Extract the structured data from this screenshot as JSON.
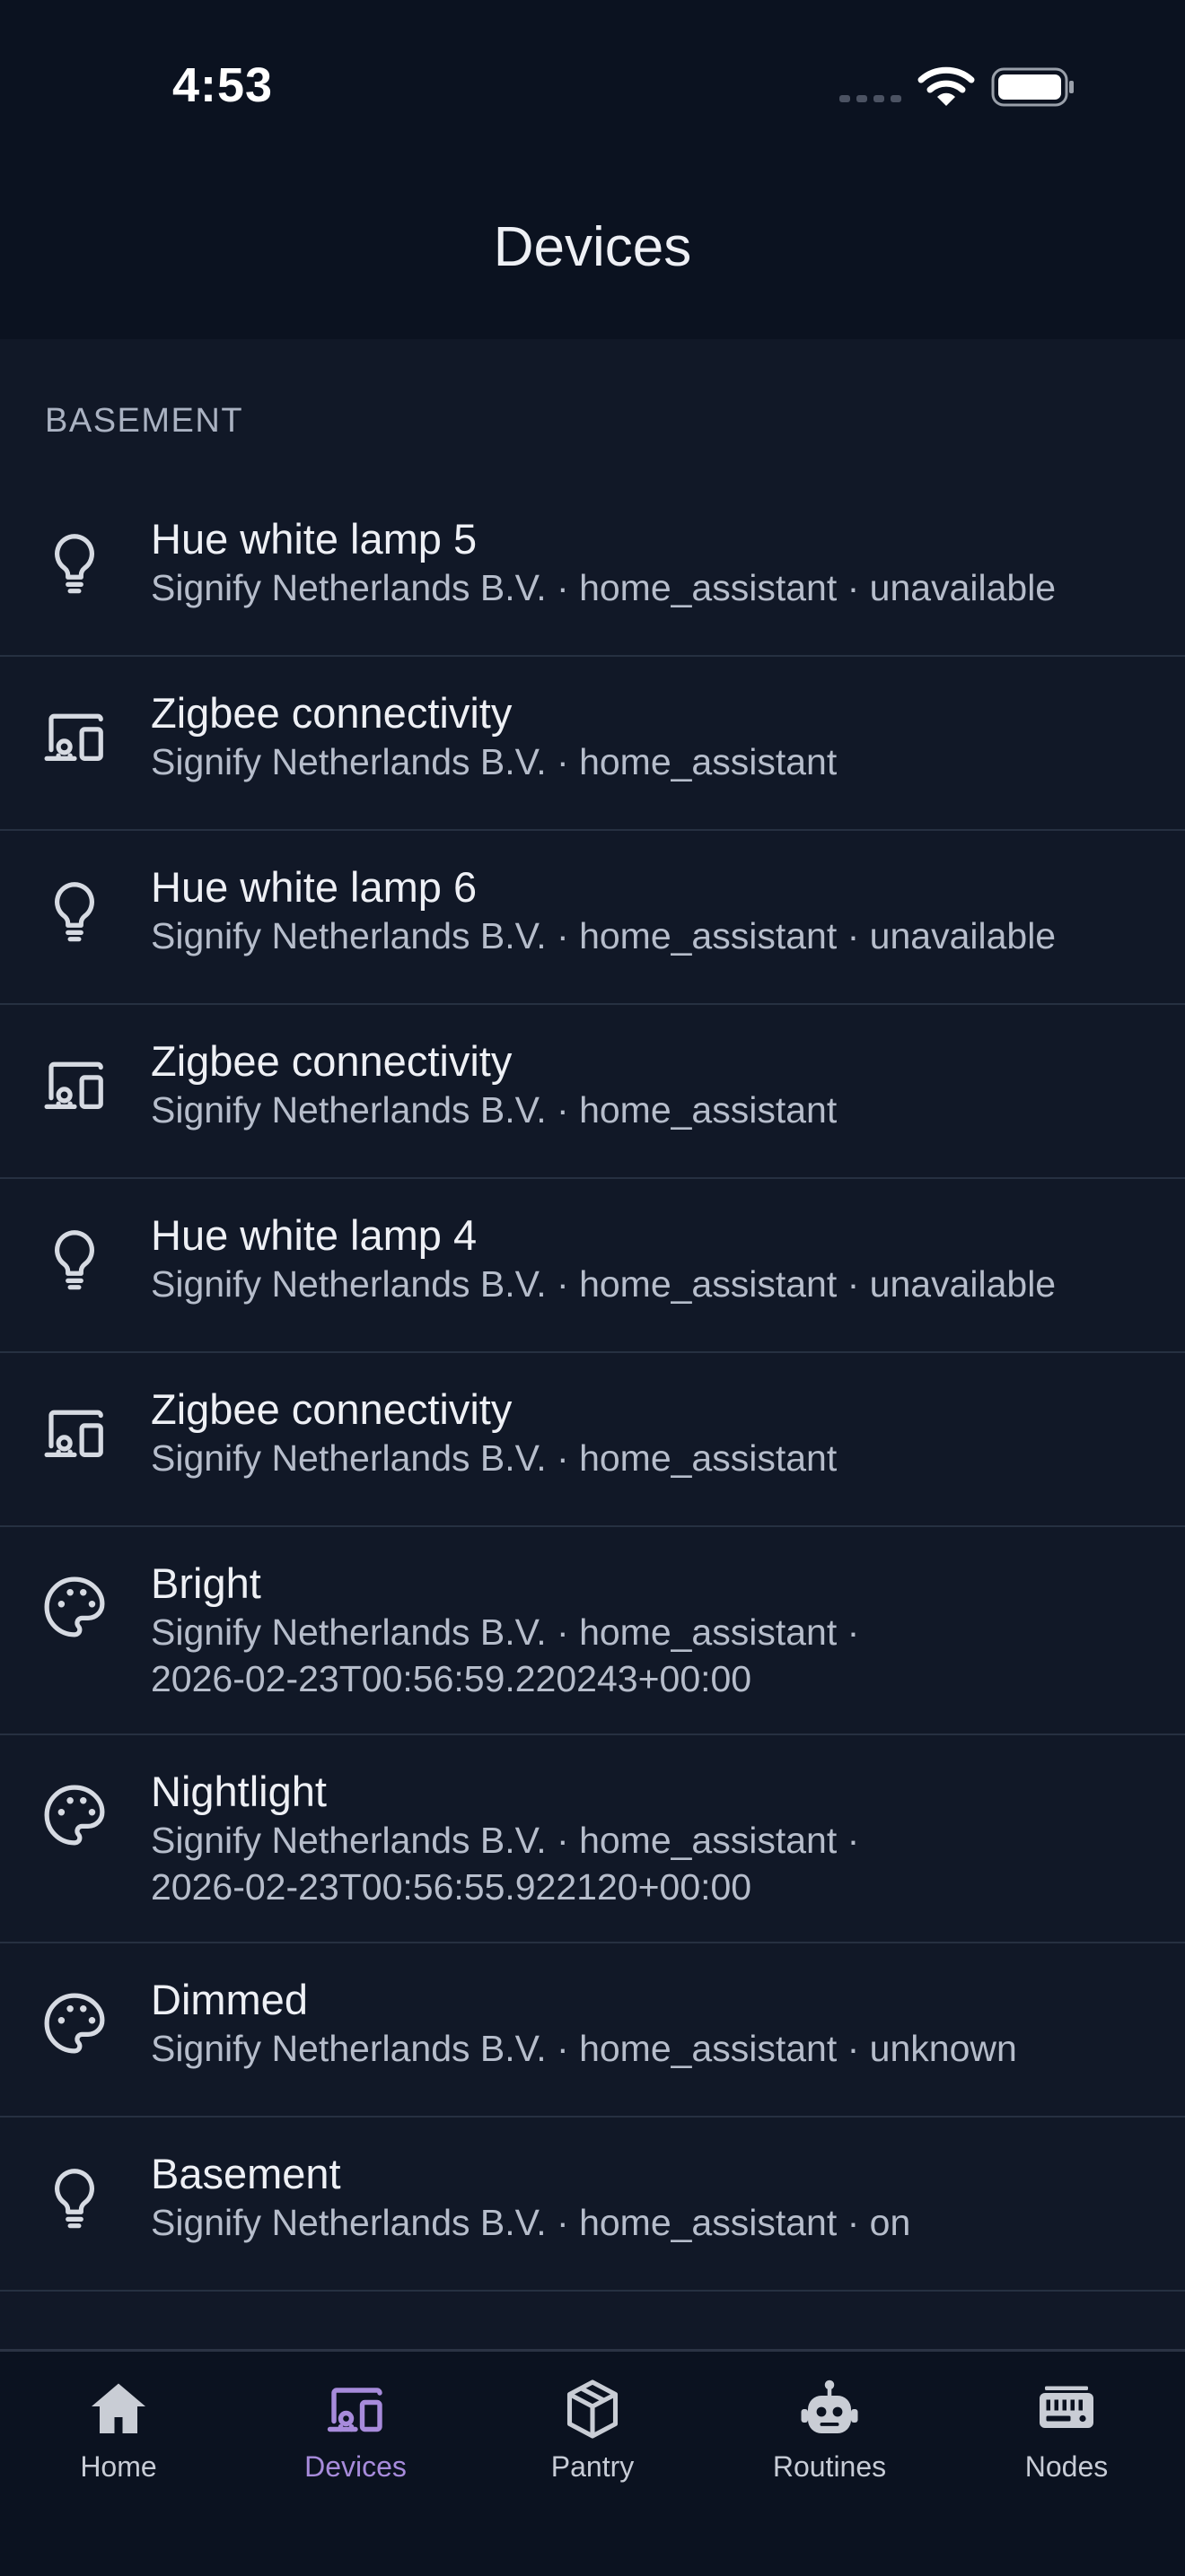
{
  "status_bar": {
    "time": "4:53"
  },
  "header": {
    "title": "Devices"
  },
  "section": {
    "title": "BASEMENT"
  },
  "devices": [
    {
      "icon": "lightbulb-icon",
      "name": "Hue white lamp 5",
      "subtitle": "Signify Netherlands B.V. · home_assistant · unavailable"
    },
    {
      "icon": "devices-icon",
      "name": "Zigbee connectivity",
      "subtitle": "Signify Netherlands B.V. · home_assistant"
    },
    {
      "icon": "lightbulb-icon",
      "name": "Hue white lamp 6",
      "subtitle": "Signify Netherlands B.V. · home_assistant · unavailable"
    },
    {
      "icon": "devices-icon",
      "name": "Zigbee connectivity",
      "subtitle": "Signify Netherlands B.V. · home_assistant"
    },
    {
      "icon": "lightbulb-icon",
      "name": "Hue white lamp 4",
      "subtitle": "Signify Netherlands B.V. · home_assistant · unavailable"
    },
    {
      "icon": "devices-icon",
      "name": "Zigbee connectivity",
      "subtitle": "Signify Netherlands B.V. · home_assistant"
    },
    {
      "icon": "palette-icon",
      "name": "Bright",
      "subtitle": "Signify Netherlands B.V. · home_assistant ·",
      "subtitle2": "2026-02-23T00:56:59.220243+00:00"
    },
    {
      "icon": "palette-icon",
      "name": "Nightlight",
      "subtitle": "Signify Netherlands B.V. · home_assistant ·",
      "subtitle2": "2026-02-23T00:56:55.922120+00:00"
    },
    {
      "icon": "palette-icon",
      "name": "Dimmed",
      "subtitle": "Signify Netherlands B.V. · home_assistant · unknown"
    },
    {
      "icon": "lightbulb-icon",
      "name": "Basement",
      "subtitle": "Signify Netherlands B.V. · home_assistant · on"
    }
  ],
  "tabs": [
    {
      "label": "Home",
      "icon": "home-icon",
      "active": false
    },
    {
      "label": "Devices",
      "icon": "devices-icon",
      "active": true
    },
    {
      "label": "Pantry",
      "icon": "package-icon",
      "active": false
    },
    {
      "label": "Routines",
      "icon": "robot-icon",
      "active": false
    },
    {
      "label": "Nodes",
      "icon": "server-icon",
      "active": false
    }
  ],
  "colors": {
    "background": "#111827",
    "bar_background": "#0b1220",
    "accent": "#a78bdb",
    "text_primary": "#eef0f5",
    "text_secondary": "#b6bdcb",
    "divider": "#263041"
  }
}
